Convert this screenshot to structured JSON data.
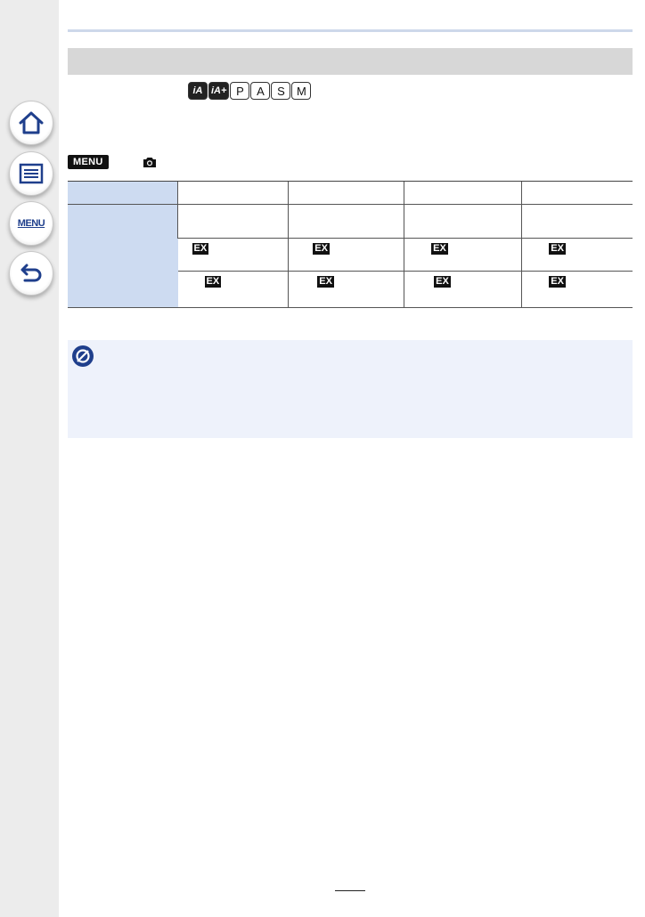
{
  "sidebar": {
    "buttons": [
      {
        "name": "home",
        "icon": "home-icon"
      },
      {
        "name": "contents",
        "icon": "list-icon"
      },
      {
        "name": "menu",
        "icon": "menu-icon",
        "label": "MENU"
      },
      {
        "name": "back",
        "icon": "back-arrow-icon"
      }
    ]
  },
  "modes": [
    "iA",
    "iA+",
    "P",
    "A",
    "S",
    "M"
  ],
  "menu_path": {
    "badge": "MENU",
    "icon": "camera-icon"
  },
  "table": {
    "ex_label": "EX"
  },
  "note": {
    "icon": "no-entry-icon"
  },
  "colors": {
    "sidebar_bg": "#ececec",
    "title_bar": "#d7d7d7",
    "label_cell": "#cddbf1",
    "note_bg": "#eef2fb",
    "icon_blue": "#1f3f8c"
  }
}
